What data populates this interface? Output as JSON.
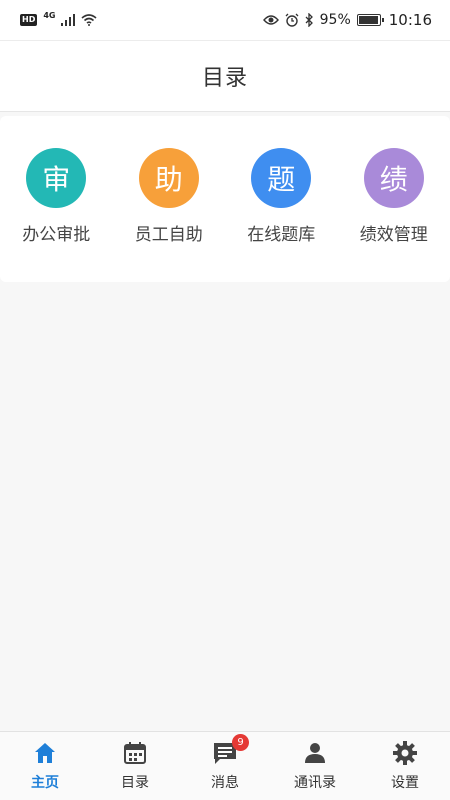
{
  "status_bar": {
    "hd_label": "HD",
    "network_label": "4G",
    "battery_percent": "95%",
    "battery_level": 0.95,
    "time": "10:16",
    "icons": [
      "signal-icon",
      "wifi-icon",
      "eye-icon",
      "alarm-icon",
      "bluetooth-icon",
      "battery-icon"
    ]
  },
  "header": {
    "title": "目录"
  },
  "apps": [
    {
      "glyph": "审",
      "label": "办公审批",
      "color": "#23b8b5"
    },
    {
      "glyph": "助",
      "label": "员工自助",
      "color": "#f7a03a"
    },
    {
      "glyph": "题",
      "label": "在线题库",
      "color": "#3f8ef0"
    },
    {
      "glyph": "绩",
      "label": "绩效管理",
      "color": "#a98ad9"
    }
  ],
  "tab_bar": {
    "active_color": "#1e7fd8",
    "tabs": [
      {
        "label": "主页",
        "icon": "home-icon",
        "active": true
      },
      {
        "label": "目录",
        "icon": "calendar-icon",
        "active": false
      },
      {
        "label": "消息",
        "icon": "message-icon",
        "active": false,
        "badge": "9"
      },
      {
        "label": "通讯录",
        "icon": "contacts-icon",
        "active": false
      },
      {
        "label": "设置",
        "icon": "gear-icon",
        "active": false
      }
    ]
  }
}
